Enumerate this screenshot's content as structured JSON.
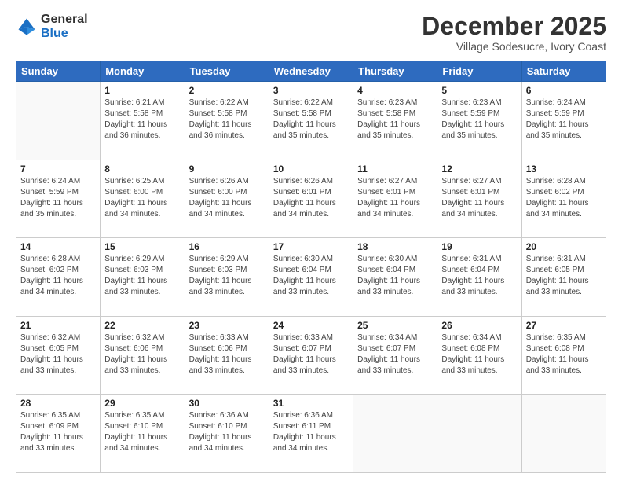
{
  "logo": {
    "general": "General",
    "blue": "Blue"
  },
  "header": {
    "month": "December 2025",
    "location": "Village Sodesucre, Ivory Coast"
  },
  "days": [
    "Sunday",
    "Monday",
    "Tuesday",
    "Wednesday",
    "Thursday",
    "Friday",
    "Saturday"
  ],
  "weeks": [
    [
      {
        "day": "",
        "info": ""
      },
      {
        "day": "1",
        "info": "Sunrise: 6:21 AM\nSunset: 5:58 PM\nDaylight: 11 hours\nand 36 minutes."
      },
      {
        "day": "2",
        "info": "Sunrise: 6:22 AM\nSunset: 5:58 PM\nDaylight: 11 hours\nand 36 minutes."
      },
      {
        "day": "3",
        "info": "Sunrise: 6:22 AM\nSunset: 5:58 PM\nDaylight: 11 hours\nand 35 minutes."
      },
      {
        "day": "4",
        "info": "Sunrise: 6:23 AM\nSunset: 5:58 PM\nDaylight: 11 hours\nand 35 minutes."
      },
      {
        "day": "5",
        "info": "Sunrise: 6:23 AM\nSunset: 5:59 PM\nDaylight: 11 hours\nand 35 minutes."
      },
      {
        "day": "6",
        "info": "Sunrise: 6:24 AM\nSunset: 5:59 PM\nDaylight: 11 hours\nand 35 minutes."
      }
    ],
    [
      {
        "day": "7",
        "info": "Sunrise: 6:24 AM\nSunset: 5:59 PM\nDaylight: 11 hours\nand 35 minutes."
      },
      {
        "day": "8",
        "info": "Sunrise: 6:25 AM\nSunset: 6:00 PM\nDaylight: 11 hours\nand 34 minutes."
      },
      {
        "day": "9",
        "info": "Sunrise: 6:26 AM\nSunset: 6:00 PM\nDaylight: 11 hours\nand 34 minutes."
      },
      {
        "day": "10",
        "info": "Sunrise: 6:26 AM\nSunset: 6:01 PM\nDaylight: 11 hours\nand 34 minutes."
      },
      {
        "day": "11",
        "info": "Sunrise: 6:27 AM\nSunset: 6:01 PM\nDaylight: 11 hours\nand 34 minutes."
      },
      {
        "day": "12",
        "info": "Sunrise: 6:27 AM\nSunset: 6:01 PM\nDaylight: 11 hours\nand 34 minutes."
      },
      {
        "day": "13",
        "info": "Sunrise: 6:28 AM\nSunset: 6:02 PM\nDaylight: 11 hours\nand 34 minutes."
      }
    ],
    [
      {
        "day": "14",
        "info": "Sunrise: 6:28 AM\nSunset: 6:02 PM\nDaylight: 11 hours\nand 34 minutes."
      },
      {
        "day": "15",
        "info": "Sunrise: 6:29 AM\nSunset: 6:03 PM\nDaylight: 11 hours\nand 33 minutes."
      },
      {
        "day": "16",
        "info": "Sunrise: 6:29 AM\nSunset: 6:03 PM\nDaylight: 11 hours\nand 33 minutes."
      },
      {
        "day": "17",
        "info": "Sunrise: 6:30 AM\nSunset: 6:04 PM\nDaylight: 11 hours\nand 33 minutes."
      },
      {
        "day": "18",
        "info": "Sunrise: 6:30 AM\nSunset: 6:04 PM\nDaylight: 11 hours\nand 33 minutes."
      },
      {
        "day": "19",
        "info": "Sunrise: 6:31 AM\nSunset: 6:04 PM\nDaylight: 11 hours\nand 33 minutes."
      },
      {
        "day": "20",
        "info": "Sunrise: 6:31 AM\nSunset: 6:05 PM\nDaylight: 11 hours\nand 33 minutes."
      }
    ],
    [
      {
        "day": "21",
        "info": "Sunrise: 6:32 AM\nSunset: 6:05 PM\nDaylight: 11 hours\nand 33 minutes."
      },
      {
        "day": "22",
        "info": "Sunrise: 6:32 AM\nSunset: 6:06 PM\nDaylight: 11 hours\nand 33 minutes."
      },
      {
        "day": "23",
        "info": "Sunrise: 6:33 AM\nSunset: 6:06 PM\nDaylight: 11 hours\nand 33 minutes."
      },
      {
        "day": "24",
        "info": "Sunrise: 6:33 AM\nSunset: 6:07 PM\nDaylight: 11 hours\nand 33 minutes."
      },
      {
        "day": "25",
        "info": "Sunrise: 6:34 AM\nSunset: 6:07 PM\nDaylight: 11 hours\nand 33 minutes."
      },
      {
        "day": "26",
        "info": "Sunrise: 6:34 AM\nSunset: 6:08 PM\nDaylight: 11 hours\nand 33 minutes."
      },
      {
        "day": "27",
        "info": "Sunrise: 6:35 AM\nSunset: 6:08 PM\nDaylight: 11 hours\nand 33 minutes."
      }
    ],
    [
      {
        "day": "28",
        "info": "Sunrise: 6:35 AM\nSunset: 6:09 PM\nDaylight: 11 hours\nand 33 minutes."
      },
      {
        "day": "29",
        "info": "Sunrise: 6:35 AM\nSunset: 6:10 PM\nDaylight: 11 hours\nand 34 minutes."
      },
      {
        "day": "30",
        "info": "Sunrise: 6:36 AM\nSunset: 6:10 PM\nDaylight: 11 hours\nand 34 minutes."
      },
      {
        "day": "31",
        "info": "Sunrise: 6:36 AM\nSunset: 6:11 PM\nDaylight: 11 hours\nand 34 minutes."
      },
      {
        "day": "",
        "info": ""
      },
      {
        "day": "",
        "info": ""
      },
      {
        "day": "",
        "info": ""
      }
    ]
  ]
}
